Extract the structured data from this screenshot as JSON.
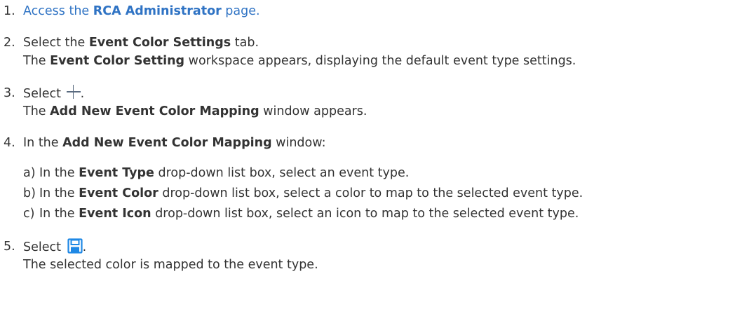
{
  "steps": [
    {
      "num": "1.",
      "text_prefix": "Access the ",
      "bold": "RCA Administrator",
      "text_suffix": " page."
    },
    {
      "num": "2.",
      "line1_prefix": "Select the ",
      "line1_bold": "Event Color Settings",
      "line1_suffix": " tab.",
      "line2_prefix": "The ",
      "line2_bold": "Event Color Setting",
      "line2_suffix": " workspace appears, displaying the default event type settings."
    },
    {
      "num": "3.",
      "line1_prefix": "Select ",
      "line1_icon": "plus-icon",
      "line1_suffix": ".",
      "line2_prefix": "The ",
      "line2_bold": "Add New Event Color Mapping",
      "line2_suffix": " window appears."
    },
    {
      "num": "4.",
      "line1_prefix": "In the ",
      "line1_bold": "Add New Event Color Mapping",
      "line1_suffix": " window:",
      "substeps": [
        {
          "letter": "a)",
          "prefix": "In the ",
          "bold": "Event Type",
          "suffix": " drop-down list box, select an event type."
        },
        {
          "letter": "b)",
          "prefix": "In the ",
          "bold": "Event Color",
          "suffix": " drop-down list box, select a color to map to the selected event type."
        },
        {
          "letter": "c)",
          "prefix": "In the ",
          "bold": "Event Icon",
          "suffix": " drop-down list box, select an icon to map to the selected event type."
        }
      ]
    },
    {
      "num": "5.",
      "line1_prefix": "Select ",
      "line1_icon": "save-icon",
      "line1_suffix": ".",
      "line2_text": "The selected color is mapped to the event type."
    }
  ],
  "colors": {
    "text": "#333333",
    "link": "#2f73c4",
    "plus_icon": "#5a6b80",
    "save_icon": "#1e88e5"
  }
}
